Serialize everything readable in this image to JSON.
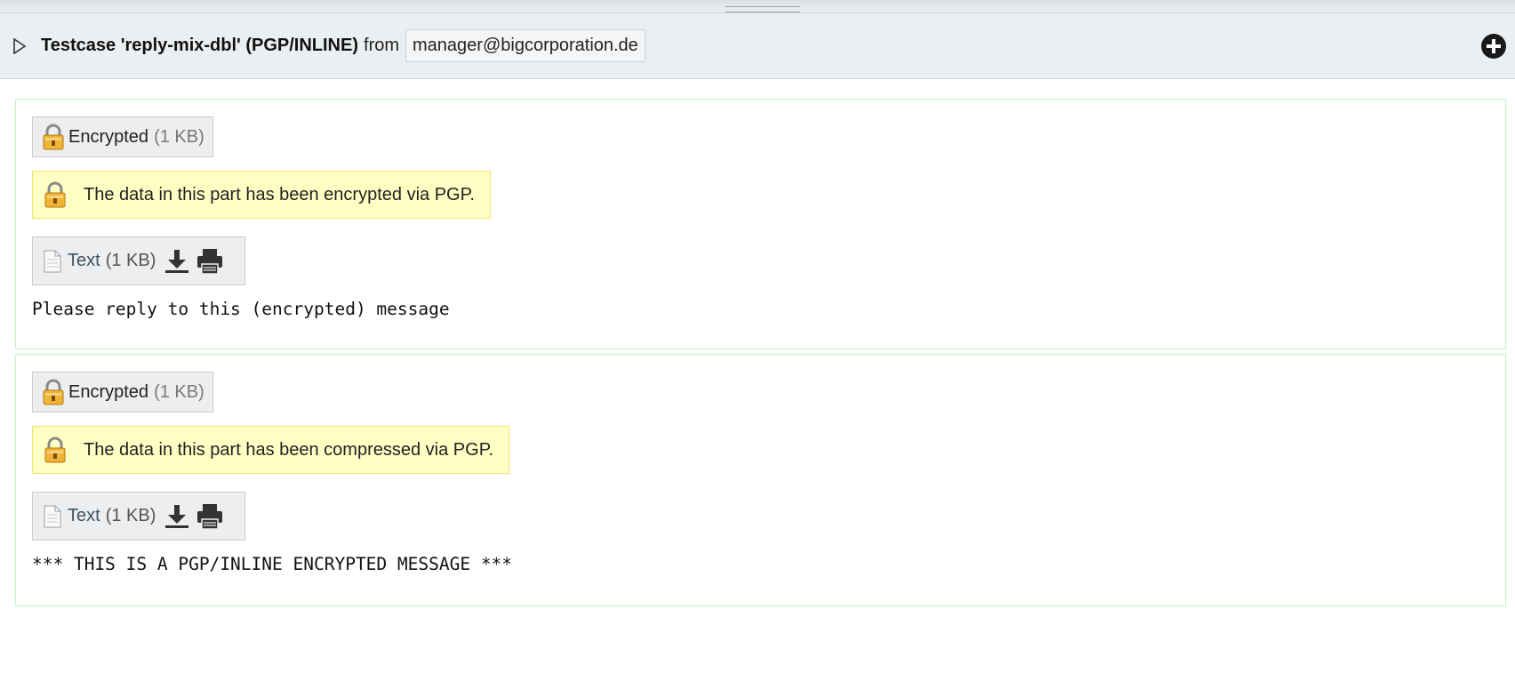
{
  "header": {
    "subject": "Testcase 'reply-mix-dbl' (PGP/INLINE)",
    "from_label": "from",
    "sender": "manager@bigcorporation.de",
    "expander_icon": "triangle-right-icon",
    "add_icon": "plus-circle-icon"
  },
  "parts": [
    {
      "encrypted_label": "Encrypted",
      "encrypted_size": "(1 KB)",
      "notice": "The data in this part has been encrypted via PGP.",
      "text_label": "Text",
      "text_size": "(1 KB)",
      "body": "Please reply to this (encrypted) message"
    },
    {
      "encrypted_label": "Encrypted",
      "encrypted_size": "(1 KB)",
      "notice": "The data in this part has been compressed via PGP.",
      "text_label": "Text",
      "text_size": "(1 KB)",
      "body": "*** THIS IS A PGP/INLINE ENCRYPTED MESSAGE ***"
    }
  ],
  "colors": {
    "notice_bg": "#ffffc4",
    "notice_border": "#f0e46a",
    "part_border": "#c8f0c8",
    "header_bg": "#eceff1"
  }
}
